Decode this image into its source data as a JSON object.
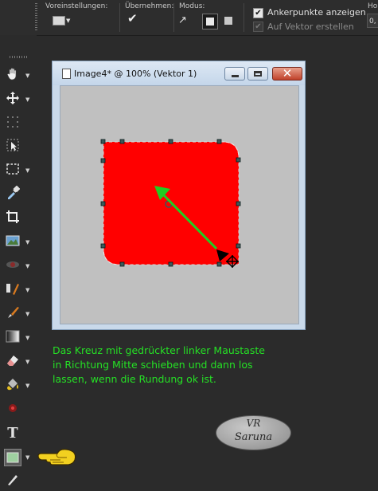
{
  "options_bar": {
    "presets_label": "Voreinstellungen:",
    "apply_label": "Übernehmen:",
    "mode_label": "Modus:",
    "anchor_points_label": "Ankerpunkte anzeigen",
    "anchor_points_checked": true,
    "on_vector_label": "Auf Vektor erstellen",
    "on_vector_checked": true,
    "on_vector_disabled": true,
    "truncated_label": "Ho",
    "truncated_value": "0,"
  },
  "toolbar": {
    "tools": [
      {
        "name": "pan-tool-icon"
      },
      {
        "name": "move-tool-icon"
      },
      {
        "name": "selection-grid-icon"
      },
      {
        "name": "pick-tool-icon"
      },
      {
        "name": "selection-tool-icon"
      },
      {
        "name": "dropper-icon"
      },
      {
        "name": "crop-icon"
      },
      {
        "name": "straighten-icon"
      },
      {
        "name": "red-eye-icon"
      },
      {
        "name": "clone-brush-icon"
      },
      {
        "name": "paint-brush-icon"
      },
      {
        "name": "gradient-icon"
      },
      {
        "name": "eraser-icon"
      },
      {
        "name": "fill-icon"
      },
      {
        "name": "retouch-icon"
      },
      {
        "name": "text-tool-icon",
        "glyph": "T"
      },
      {
        "name": "rectangle-tool-icon"
      },
      {
        "name": "pen-tool-icon"
      }
    ],
    "active_tool": "rectangle-tool-icon"
  },
  "document": {
    "title": "Image4* @ 100% (Vektor 1)",
    "shape_color": "#ff0000",
    "arrow_color": "#22cc22",
    "canvas_color": "#c0c0c0"
  },
  "instruction": {
    "lines": [
      "Das Kreuz mit gedrückter linker Maustaste",
      "in Richtung Mitte schieben und dann los",
      "lassen, wenn die Rundung ok ist."
    ],
    "color": "#25e025"
  },
  "signature": {
    "line1": "VR",
    "line2": "Saruna"
  }
}
